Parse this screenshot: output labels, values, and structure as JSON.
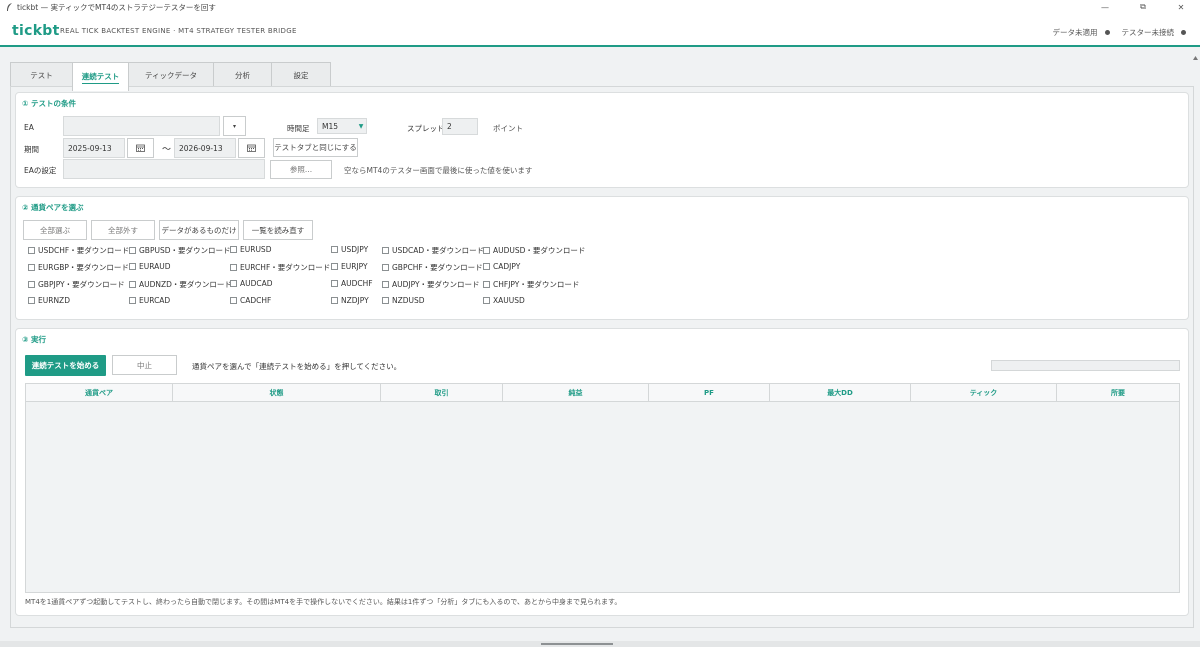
{
  "window": {
    "title": "tickbt — 実ティックでMT4のストラテジーテスターを回す",
    "controls": [
      "—",
      "⧉",
      "✕"
    ]
  },
  "header": {
    "brand": "tickbt",
    "subtitle": "REAL TICK BACKTEST ENGINE · MT4 STRATEGY TESTER BRIDGE",
    "status_data": "データ未適用",
    "status_tester": "テスター未接続"
  },
  "tabs": [
    {
      "label": "テスト",
      "active": false
    },
    {
      "label": "連続テスト",
      "active": true
    },
    {
      "label": "ティックデータ",
      "active": false
    },
    {
      "label": "分析",
      "active": false
    },
    {
      "label": "設定",
      "active": false
    }
  ],
  "conditions": {
    "title": "① テストの条件",
    "ea_label": "EA",
    "ea_value": "",
    "ea_dropdown": "▾",
    "timeframe_label": "時間足",
    "timeframe_value": "M15",
    "spread_label": "スプレッド",
    "spread_value": "2",
    "spread_unit": "ポイント",
    "period_label": "期間",
    "date_from": "2025-09-13",
    "tilde": "〜",
    "date_to": "2026-09-13",
    "same_as_test_button": "テストタブと同じにする",
    "ea_settings_label": "EAの設定",
    "ea_settings_value": "",
    "browse_button": "参照...",
    "ea_settings_note": "空ならMT4のテスター画面で最後に使った値を使います"
  },
  "pairs": {
    "title": "② 通貨ペアを選ぶ",
    "buttons": [
      "全部選ぶ",
      "全部外す",
      "データがあるものだけ",
      "一覧を読み直す"
    ],
    "rows": [
      [
        "USDCHF・要ダウンロード",
        "GBPUSD・要ダウンロード",
        "EURUSD",
        "USDJPY",
        "USDCAD・要ダウンロード",
        "AUDUSD・要ダウンロード"
      ],
      [
        "EURGBP・要ダウンロード",
        "EURAUD",
        "EURCHF・要ダウンロード",
        "EURJPY",
        "GBPCHF・要ダウンロード",
        "CADJPY"
      ],
      [
        "GBPJPY・要ダウンロード",
        "AUDNZD・要ダウンロード",
        "AUDCAD",
        "AUDCHF",
        "AUDJPY・要ダウンロード",
        "CHFJPY・要ダウンロード"
      ],
      [
        "EURNZD",
        "EURCAD",
        "CADCHF",
        "NZDJPY",
        "NZDUSD",
        "XAUUSD"
      ]
    ]
  },
  "run": {
    "title": "③ 実行",
    "start_button": "連続テストを始める",
    "stop_button": "中止",
    "hint": "通貨ペアを選んで「連続テストを始める」を押してください。",
    "progress": 0,
    "columns": [
      "通貨ペア",
      "状態",
      "取引",
      "純益",
      "PF",
      "最大DD",
      "ティック",
      "所要"
    ],
    "footnote": "MT4を1通貨ペアずつ起動してテストし、終わったら自動で閉じます。その間はMT4を手で操作しないでください。結果は1件ずつ「分析」タブにも入るので、あとから中身まで見られます。"
  },
  "colors": {
    "accent": "#1f9b86"
  }
}
